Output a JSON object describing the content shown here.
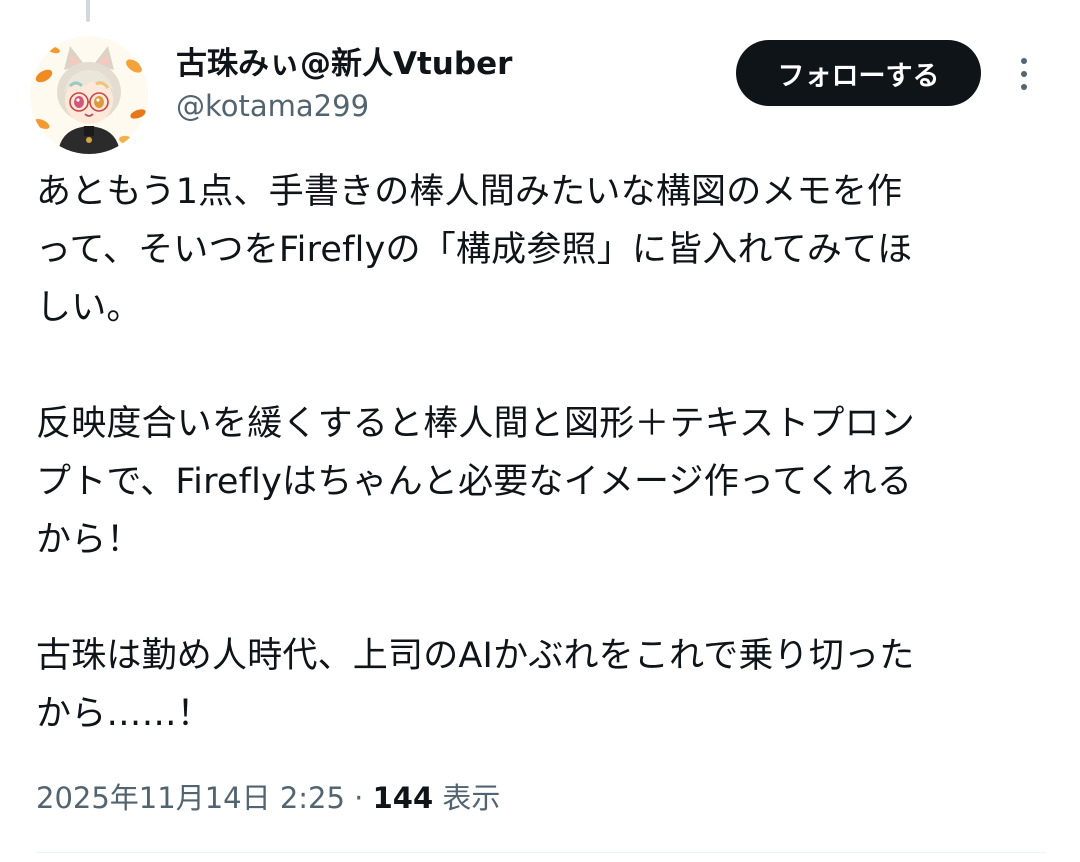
{
  "author": {
    "display_name": "古珠みぃ@新人Vtuber",
    "handle": "@kotama299",
    "avatar_icon": "vtuber-avatar-illustration"
  },
  "actions": {
    "follow_label": "フォローする",
    "more_icon": "more-vertical-icon"
  },
  "tweet": {
    "paragraphs": [
      {
        "lines": [
          "あともう1点、手書きの棒人間みたいな構図のメモを作",
          "って、そいつをFireflyの「構成参照」に皆入れてみてほ",
          "しい。"
        ]
      },
      {
        "lines": [
          "反映度合いを緩くすると棒人間と図形＋テキストプロン",
          "プトで、Fireflyはちゃんと必要なイメージ作ってくれる",
          "から！"
        ]
      },
      {
        "lines": [
          "古珠は勤め人時代、上司のAIかぶれをこれで乗り切った",
          "から……！"
        ]
      }
    ]
  },
  "meta": {
    "timestamp": "2025年11月14日 2:25",
    "separator": "·",
    "views_count": "144",
    "views_label": "表示"
  },
  "colors": {
    "text_primary": "#0f1419",
    "text_secondary": "#536471",
    "button_bg": "#0f1419",
    "button_text": "#ffffff",
    "thread_line": "#cfd9de"
  }
}
